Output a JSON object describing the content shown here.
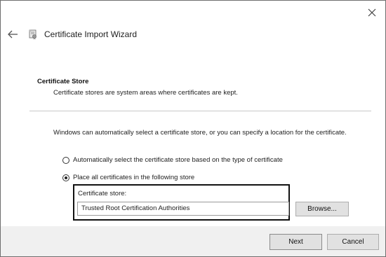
{
  "window": {
    "title": "Certificate Import Wizard"
  },
  "section": {
    "heading": "Certificate Store",
    "description": "Certificate stores are system areas where certificates are kept."
  },
  "intro_text": "Windows can automatically select a certificate store, or you can specify a location for the certificate.",
  "options": [
    {
      "label": "Automatically select the certificate store based on the type of certificate",
      "selected": false
    },
    {
      "label": "Place all certificates in the following store",
      "selected": true
    }
  ],
  "store": {
    "label": "Certificate store:",
    "value": "Trusted Root Certification Authorities",
    "browse_label": "Browse..."
  },
  "footer": {
    "next_label": "Next",
    "cancel_label": "Cancel"
  },
  "icons": {
    "close": "close-icon",
    "back": "back-arrow-icon",
    "wizard": "certificate-wizard-icon"
  }
}
